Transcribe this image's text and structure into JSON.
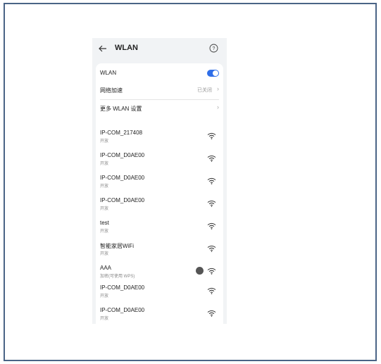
{
  "header": {
    "title": "WLAN"
  },
  "settings": {
    "wlan_label": "WLAN",
    "wlan_on": true,
    "accel_label": "网络加速",
    "accel_value": "已关闭",
    "more_label": "更多 WLAN 设置"
  },
  "networks": [
    {
      "ssid": "IP-COM_217408",
      "status": "开放"
    },
    {
      "ssid": "IP-COM_D0AE00",
      "status": "开放"
    },
    {
      "ssid": "IP-COM_D0AE00",
      "status": "开放"
    },
    {
      "ssid": "IP-COM_D0AE00",
      "status": "开放"
    },
    {
      "ssid": "test",
      "status": "开放"
    },
    {
      "ssid": "智能家居WiFi",
      "status": "开放"
    },
    {
      "ssid": "AAA",
      "status": "加密(可使用 WPS)"
    },
    {
      "ssid": "IP-COM_D0AE00",
      "status": "开放"
    },
    {
      "ssid": "IP-COM_D0AE00",
      "status": "开放"
    }
  ],
  "colors": {
    "accent": "#2f6ee8",
    "frame": "#4a6486",
    "bg": "#f1f3f5"
  },
  "icons": {
    "back": "arrow-left-icon",
    "help": "question-circle-icon",
    "wifi": "wifi-icon",
    "wps": "wps-icon",
    "chevron": "chevron-right-icon"
  }
}
